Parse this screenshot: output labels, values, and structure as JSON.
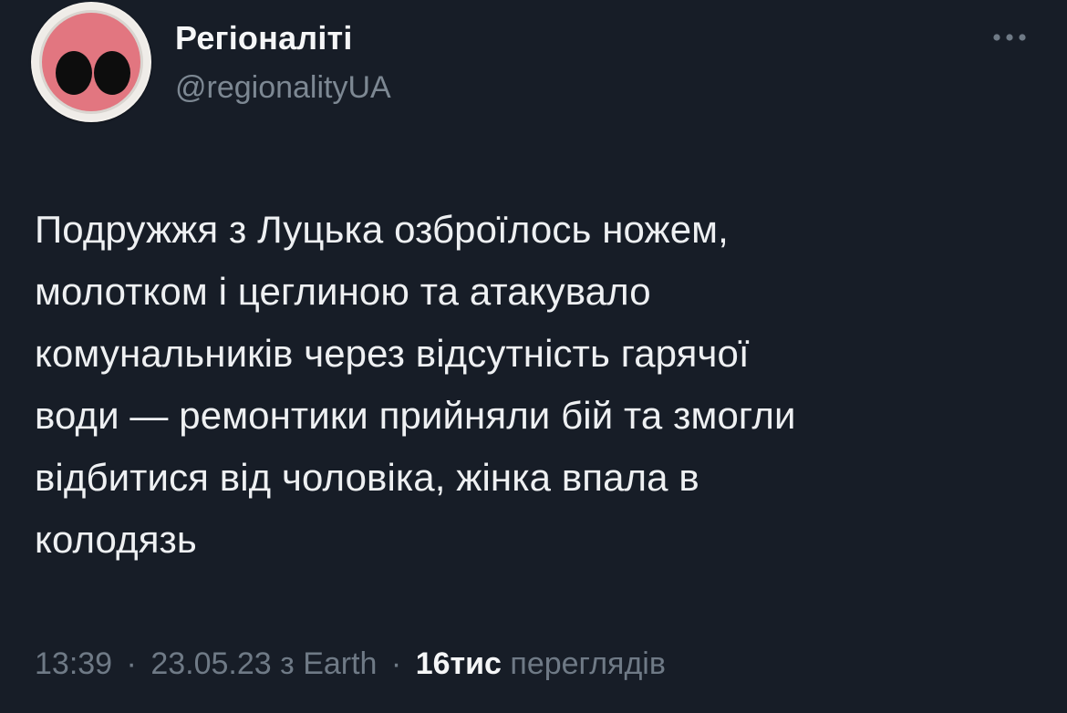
{
  "author": {
    "display_name": "Регіоналіті",
    "handle": "@regionalityUA"
  },
  "avatar": {
    "icon": "pig-snout-icon",
    "ring_color": "#e8e4df",
    "snout_color": "#e27680",
    "nostril_color": "#0d0d0d"
  },
  "tweet": {
    "text": "Подружжя з Луцька озброїлось ножем,\nмолотком і цеглиною та атакувало\nкомунальників через відсутність гарячої\nводи — ремонтики прийняли бій та змогли\nвідбитися від чоловіка, жінка впала в\nколодязь"
  },
  "meta": {
    "time": "13:39",
    "separator": "·",
    "date": "23.05.23",
    "source_prefix": "з",
    "source": "Earth",
    "views_count": "16тис",
    "views_label": "переглядів"
  },
  "more_icon": "more-horizontal-icon",
  "colors": {
    "background": "#171d27",
    "text_primary": "#eef0f2",
    "text_secondary": "#6f7a86"
  }
}
